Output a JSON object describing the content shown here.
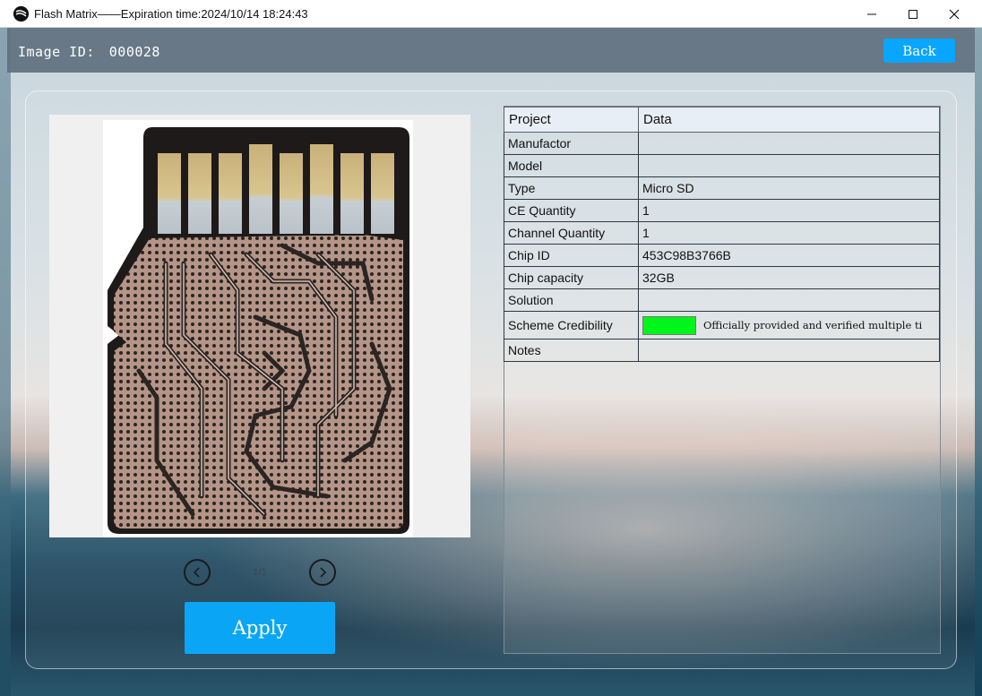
{
  "window": {
    "title": "Flash Matrix——Expiration time:2024/10/14 18:24:43",
    "controls": {
      "minimize": "—",
      "maximize": "☐",
      "close": "✕"
    }
  },
  "header": {
    "image_id_label": "Image ID:",
    "image_id_value": "000028",
    "back_label": "Back"
  },
  "viewer": {
    "image_subject": "micro-sd-card-pcb-photo",
    "page_indicator": "1/1",
    "prev_icon": "chevron-left-icon",
    "next_icon": "chevron-right-icon"
  },
  "actions": {
    "apply_label": "Apply"
  },
  "table": {
    "headers": [
      "Project",
      "Data"
    ],
    "rows": [
      {
        "label": "Manufactor",
        "value": ""
      },
      {
        "label": "Model",
        "value": ""
      },
      {
        "label": "Type",
        "value": "Micro SD"
      },
      {
        "label": "CE Quantity",
        "value": "1"
      },
      {
        "label": "Channel Quantity",
        "value": "1"
      },
      {
        "label": "Chip ID",
        "value": "453C98B3766B"
      },
      {
        "label": "Chip capacity",
        "value": "32GB"
      },
      {
        "label": "Solution",
        "value": ""
      },
      {
        "label": "Scheme Credibility",
        "value": "Officially provided and verified multiple ti",
        "indicator_color": "#00f51a"
      },
      {
        "label": "Notes",
        "value": ""
      }
    ]
  },
  "colors": {
    "accent_button": "#09a6ff",
    "header_band": "#60707e",
    "credibility_indicator": "#00f51a"
  }
}
